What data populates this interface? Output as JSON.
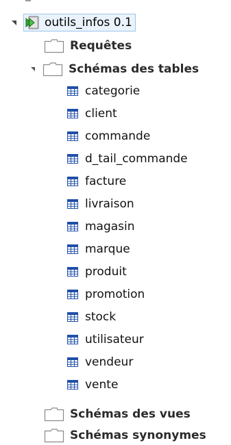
{
  "tree": {
    "root": {
      "label": "outils_infos 0.1",
      "icon": "database-project-icon"
    },
    "folders": {
      "requetes": "Requêtes",
      "schemas_tables": "Schémas des tables",
      "schemas_vues": "Schémas des vues",
      "schemas_synonymes": "Schémas synonymes"
    },
    "tables": [
      "categorie",
      "client",
      "commande",
      "d_tail_commande",
      "facture",
      "livraison",
      "magasin",
      "marque",
      "produit",
      "promotion",
      "stock",
      "utilisateur",
      "vendeur",
      "vente"
    ]
  },
  "colors": {
    "selection_border": "#9dc4ec",
    "selection_bg": "#eaf3fc",
    "table_icon": "#1f4fa8",
    "folder_outline": "#8a8a8a"
  }
}
